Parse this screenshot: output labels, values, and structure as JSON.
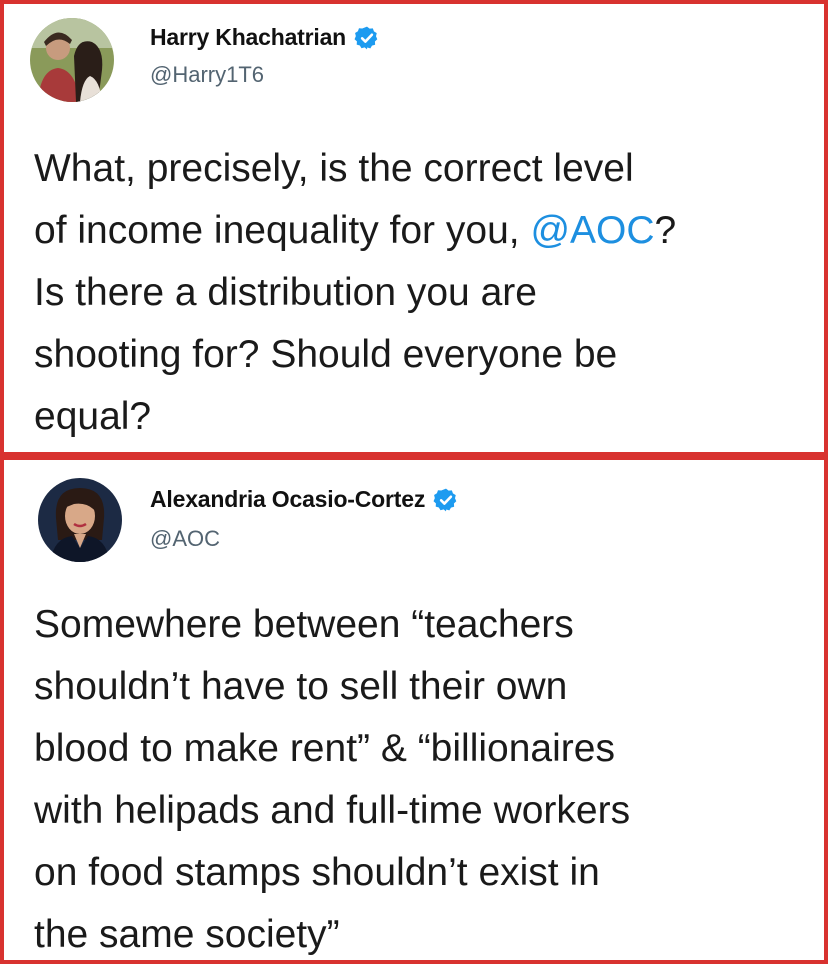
{
  "tweets": [
    {
      "author": {
        "name": "Harry Khachatrian",
        "handle": "@Harry1T6",
        "verified": true,
        "avatar_icon": "profile-photo-couple"
      },
      "text": {
        "before_mention": "What, precisely, is the correct level\nof income inequality for you, ",
        "mention": "@AOC",
        "after_mention": "?\nIs there a distribution you are\nshooting for? Should everyone be\nequal?"
      }
    },
    {
      "author": {
        "name": "Alexandria Ocasio-Cortez",
        "handle": "@AOC",
        "verified": true,
        "avatar_icon": "profile-photo-woman"
      },
      "text": {
        "full": "Somewhere between “teachers\nshouldn’t have to sell their own\nblood to make rent” & “billionaires\nwith helipads and full-time workers\non food stamps shouldn’t exist in\nthe same society”"
      }
    }
  ],
  "colors": {
    "frame": "#d8322f",
    "verified_badge": "#1d9bf0",
    "mention": "#1d8fe0",
    "handle": "#536471"
  }
}
